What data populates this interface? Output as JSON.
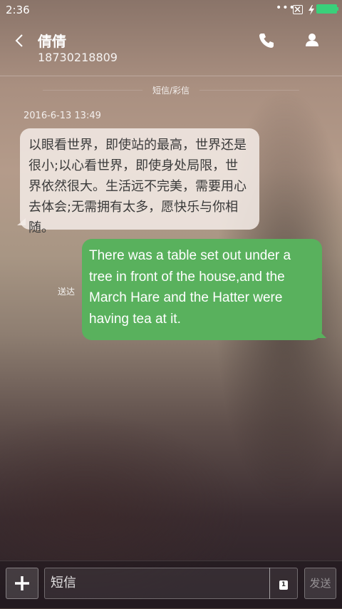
{
  "status_bar": {
    "time": "2:36",
    "dots": "•••"
  },
  "header": {
    "contact_name": "倩倩",
    "contact_number": "18730218809"
  },
  "conversation": {
    "section_label": "短信/彩信",
    "timestamp": "2016-6-13 13:49",
    "incoming_message": "以眼看世界，即使站的最高，世界还是很小;以心看世界，即使身处局限，世界依然很大。生活远不完美，需要用心去体会;无需拥有太多，愿快乐与你相随。",
    "sent_status": "送达",
    "outgoing_message": "There was a table set out under a tree in front of the house,and the March Hare and the Hatter were having tea at it."
  },
  "compose": {
    "input_placeholder": "短信",
    "send_label": "发送",
    "attach_badge": "1"
  },
  "colors": {
    "outgoing_bubble": "#59b15d",
    "incoming_bubble": "#f3ebe6",
    "battery": "#3ad07a"
  },
  "icons": {
    "back": "chevron-left-icon",
    "phone": "phone-icon",
    "person": "person-icon",
    "add": "plus-icon",
    "attach": "sim-card-icon"
  }
}
